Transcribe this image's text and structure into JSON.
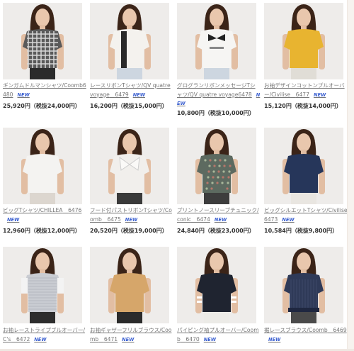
{
  "badge_text": "NEW",
  "products": [
    {
      "name": "ギンガムドルマンシャツ/Coomb",
      "code": "6480",
      "price": "25,920円（税抜24,000円）",
      "top": "#5a5a5a",
      "bottom": "#2b2b2b",
      "pattern": "check"
    },
    {
      "name": "レースリボンTシャツ/QV quatre voyage",
      "code": "6479",
      "price": "16,200円（税抜15,000円）",
      "top": "#f4f2ee",
      "bottom": "#cdd6e0",
      "pattern": "ribbon"
    },
    {
      "name": "グログランリボンメッセージTシャツ/QV quatre voyage",
      "code": "6478",
      "price": "10,800円（税抜10,000円）",
      "top": "#f6f5f3",
      "bottom": "#cdd6e0",
      "pattern": "bow"
    },
    {
      "name": "お袖デザインコットンプルオーバー/Civilise",
      "code": "6477",
      "price": "15,120円（税抜14,000円）",
      "top": "#e8b430",
      "bottom": "#e0ddd6",
      "pattern": "plain"
    },
    {
      "name": "ビッグTシャツ/CHILLEA",
      "code": "6476",
      "price": "12,960円（税抜12,000円）",
      "top": "#f4f3f1",
      "bottom": "#dcd6cf",
      "pattern": "plain"
    },
    {
      "name": "フード付パストリボンTシャツ/Coomb",
      "code": "6475",
      "price": "20,520円（税抜19,000円）",
      "top": "#f1efec",
      "bottom": "#3a3a3a",
      "pattern": "bowbig"
    },
    {
      "name": "プリントノースリーブチュニック/conic",
      "code": "6474",
      "price": "24,840円（税抜23,000円）",
      "top": "#5d6a60",
      "bottom": "#3d3d3d",
      "pattern": "floral"
    },
    {
      "name": "ビッグシルエットTシャツ/Civilise",
      "code": "6473",
      "price": "10,584円（税抜9,800円）",
      "top": "#26365a",
      "bottom": "#e9e6e1",
      "pattern": "plain"
    },
    {
      "name": "お袖レーストライプブルオーバー/C's",
      "code": "6472",
      "price": "",
      "top": "#c9ccd2",
      "bottom": "#2d2d2d",
      "pattern": "stripe"
    },
    {
      "name": "お袖ギャザーフリルブラウス/Coomb",
      "code": "6471",
      "price": "",
      "top": "#d6a66a",
      "bottom": "#2b2b2b",
      "pattern": "plain"
    },
    {
      "name": "パイピング袖プルオーバー/Coomb",
      "code": "6470",
      "price": "",
      "top": "#1f2430",
      "bottom": "#ecebe7",
      "pattern": "piping"
    },
    {
      "name": "裾レースブラウス/Coomb",
      "code": "6469",
      "price": "",
      "top": "#2f3a58",
      "bottom": "#4a4a4a",
      "pattern": "pleat"
    }
  ]
}
